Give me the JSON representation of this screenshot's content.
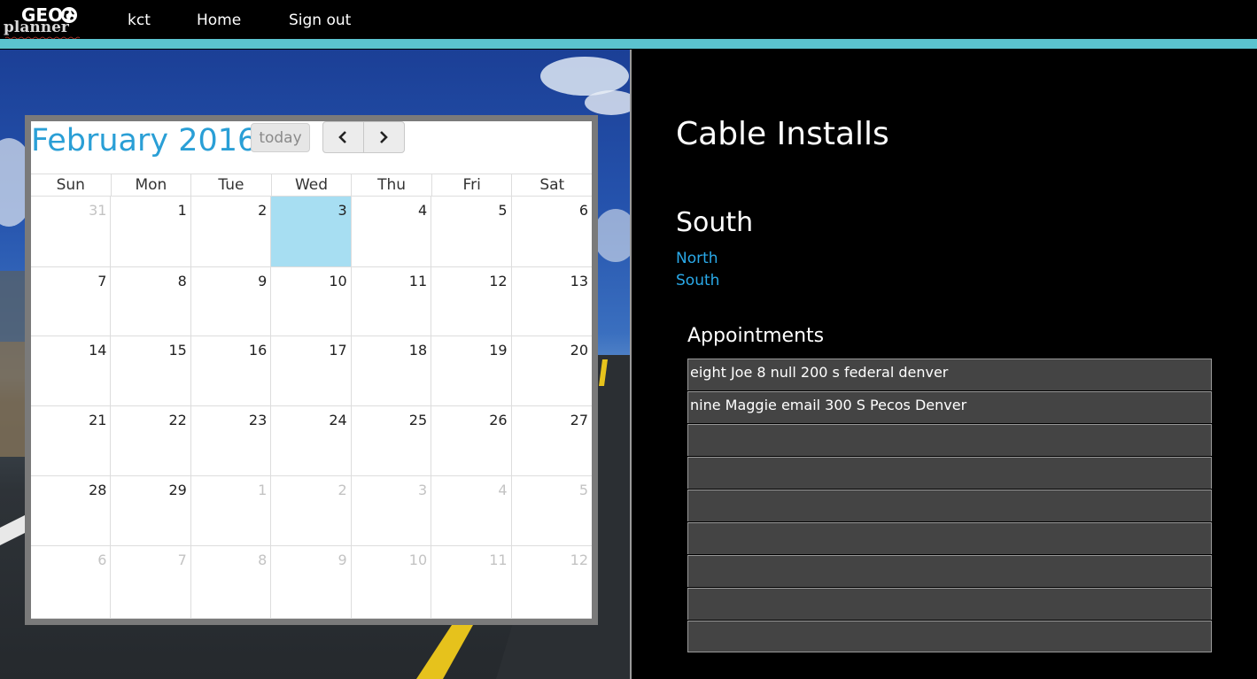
{
  "nav": {
    "logo_top": "GEO",
    "logo_bottom": "planner",
    "user": "kct",
    "home": "Home",
    "signout": "Sign out",
    "accent_color": "#5bc3cf"
  },
  "calendar": {
    "title": "February 2016",
    "today_label": "today",
    "prev_icon": "chevron-left-icon",
    "next_icon": "chevron-right-icon",
    "day_headers": [
      "Sun",
      "Mon",
      "Tue",
      "Wed",
      "Thu",
      "Fri",
      "Sat"
    ],
    "weeks": [
      [
        {
          "d": "31",
          "other": true
        },
        {
          "d": "1"
        },
        {
          "d": "2"
        },
        {
          "d": "3",
          "today": true
        },
        {
          "d": "4"
        },
        {
          "d": "5"
        },
        {
          "d": "6"
        }
      ],
      [
        {
          "d": "7"
        },
        {
          "d": "8"
        },
        {
          "d": "9"
        },
        {
          "d": "10"
        },
        {
          "d": "11"
        },
        {
          "d": "12"
        },
        {
          "d": "13"
        }
      ],
      [
        {
          "d": "14"
        },
        {
          "d": "15"
        },
        {
          "d": "16"
        },
        {
          "d": "17"
        },
        {
          "d": "18"
        },
        {
          "d": "19"
        },
        {
          "d": "20"
        }
      ],
      [
        {
          "d": "21"
        },
        {
          "d": "22"
        },
        {
          "d": "23"
        },
        {
          "d": "24"
        },
        {
          "d": "25"
        },
        {
          "d": "26"
        },
        {
          "d": "27"
        }
      ],
      [
        {
          "d": "28"
        },
        {
          "d": "29"
        },
        {
          "d": "1",
          "other": true
        },
        {
          "d": "2",
          "other": true
        },
        {
          "d": "3",
          "other": true
        },
        {
          "d": "4",
          "other": true
        },
        {
          "d": "5",
          "other": true
        }
      ],
      [
        {
          "d": "6",
          "other": true
        },
        {
          "d": "7",
          "other": true
        },
        {
          "d": "8",
          "other": true
        },
        {
          "d": "9",
          "other": true
        },
        {
          "d": "10",
          "other": true
        },
        {
          "d": "11",
          "other": true
        },
        {
          "d": "12",
          "other": true
        }
      ]
    ],
    "today_color": "#a7def2",
    "title_color": "#2a9fd6"
  },
  "main": {
    "title": "Cable Installs",
    "region": "South",
    "region_links": [
      "North",
      "South"
    ],
    "link_color": "#2aa9e8",
    "appointments_heading": "Appointments",
    "appointments": [
      "eight Joe 8 null 200 s federal denver",
      "nine Maggie email 300 S Pecos Denver",
      "",
      "",
      "",
      "",
      "",
      "",
      ""
    ]
  }
}
